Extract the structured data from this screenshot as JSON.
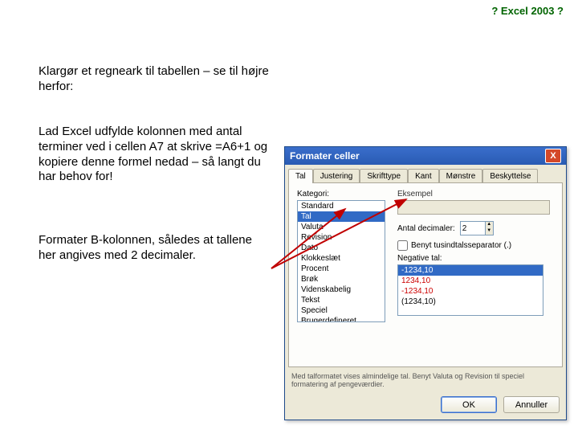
{
  "page": {
    "title": "? Excel 2003 ?"
  },
  "paragraphs": {
    "p1": "Klargør et regneark til tabellen – se til højre herfor:",
    "p2": "Lad Excel udfylde kolonnen med antal terminer ved i cellen A7 at skrive =A6+1 og kopiere denne formel nedad – så langt du har behov for!",
    "p3": "Formater B-kolonnen, således at tallene her angives med 2 decimaler."
  },
  "dialog": {
    "title": "Formater celler",
    "close_icon": "X",
    "tabs": [
      "Tal",
      "Justering",
      "Skrifttype",
      "Kant",
      "Mønstre",
      "Beskyttelse"
    ],
    "active_tab": 0,
    "category_label": "Kategori:",
    "categories": [
      "Standard",
      "Tal",
      "Valuta",
      "Revision",
      "Dato",
      "Klokkeslæt",
      "Procent",
      "Brøk",
      "Videnskabelig",
      "Tekst",
      "Speciel",
      "Brugerdefineret"
    ],
    "category_selected": 1,
    "sample_label": "Eksempel",
    "decimals_label": "Antal decimaler:",
    "decimals_value": "2",
    "thousand_label": "Benyt tusindtalsseparator (.)",
    "thousand_checked": false,
    "negative_label": "Negative tal:",
    "negatives": [
      {
        "text": "-1234,10",
        "red": false,
        "sel": true
      },
      {
        "text": "1234,10",
        "red": true,
        "sel": false
      },
      {
        "text": "-1234,10",
        "red": true,
        "sel": false
      },
      {
        "text": "(1234,10)",
        "red": false,
        "sel": false
      }
    ],
    "description": "Med talformatet vises almindelige tal. Benyt Valuta og Revision til speciel formatering af pengeværdier.",
    "ok_label": "OK",
    "cancel_label": "Annuller"
  }
}
